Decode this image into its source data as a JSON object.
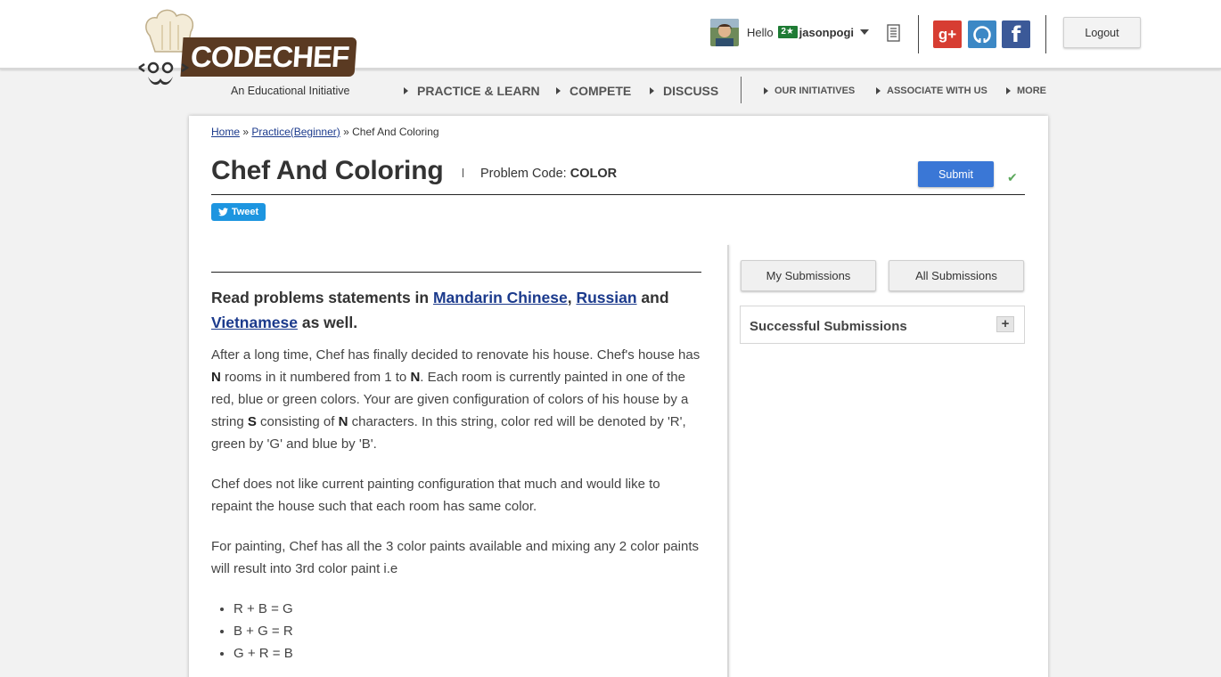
{
  "logo": {
    "wordmark": "CODECHEF",
    "tagline": "An Educational Initiative"
  },
  "user": {
    "greeting": "Hello",
    "star_badge": "2★",
    "username": "jasonpogi"
  },
  "social": {
    "gplus": "g+",
    "facebook": "f"
  },
  "header": {
    "logout_label": "Logout"
  },
  "nav": {
    "main": [
      "PRACTICE & LEARN",
      "COMPETE",
      "DISCUSS"
    ],
    "secondary": [
      "OUR INITIATIVES",
      "ASSOCIATE WITH US",
      "MORE"
    ]
  },
  "breadcrumb": {
    "home": "Home",
    "sep1": "»",
    "practice": "Practice(Beginner)",
    "sep2": "»",
    "current": "Chef And Coloring"
  },
  "problem": {
    "title": "Chef And Coloring",
    "code_label": "Problem Code:",
    "code": "COLOR",
    "submit_label": "Submit",
    "tweet_label": "Tweet"
  },
  "statement": {
    "read_prefix": "Read problems statements in",
    "lang1": "Mandarin Chinese",
    "comma": ",",
    "lang2": "Russian",
    "and": "and",
    "lang3": "Vietnamese",
    "read_suffix": "as well.",
    "p1": {
      "a": "After a long time, Chef has finally decided to renovate his house. Chef's house has ",
      "n1": "N",
      "b": " rooms in it numbered from 1 to ",
      "n2": "N",
      "c": ". Each room is currently painted in one of the red, blue or green colors. Your are given configuration of colors of his house by a string ",
      "s": "S",
      "d": " consisting of ",
      "n3": "N",
      "e": " characters. In this string, color red will be denoted by 'R', green by 'G' and blue by 'B'."
    },
    "p2": "Chef does not like current painting configuration that much and would like to repaint the house such that each room has same color.",
    "p3": "For painting, Chef has all the 3 color paints available and mixing any 2 color paints will result into 3rd color paint i.e",
    "rules": [
      "R + B = G",
      "B + G = R",
      "G + R = B"
    ]
  },
  "sidebar": {
    "my_submissions": "My Submissions",
    "all_submissions": "All Submissions",
    "successful_title": "Successful Submissions",
    "expand_symbol": "+"
  },
  "colors": {
    "accent": "#3a77d6",
    "link": "#1b3a8c",
    "brand_brown": "#5a3a22",
    "tweet": "#1d95e0",
    "star_green": "#1e7b34"
  }
}
